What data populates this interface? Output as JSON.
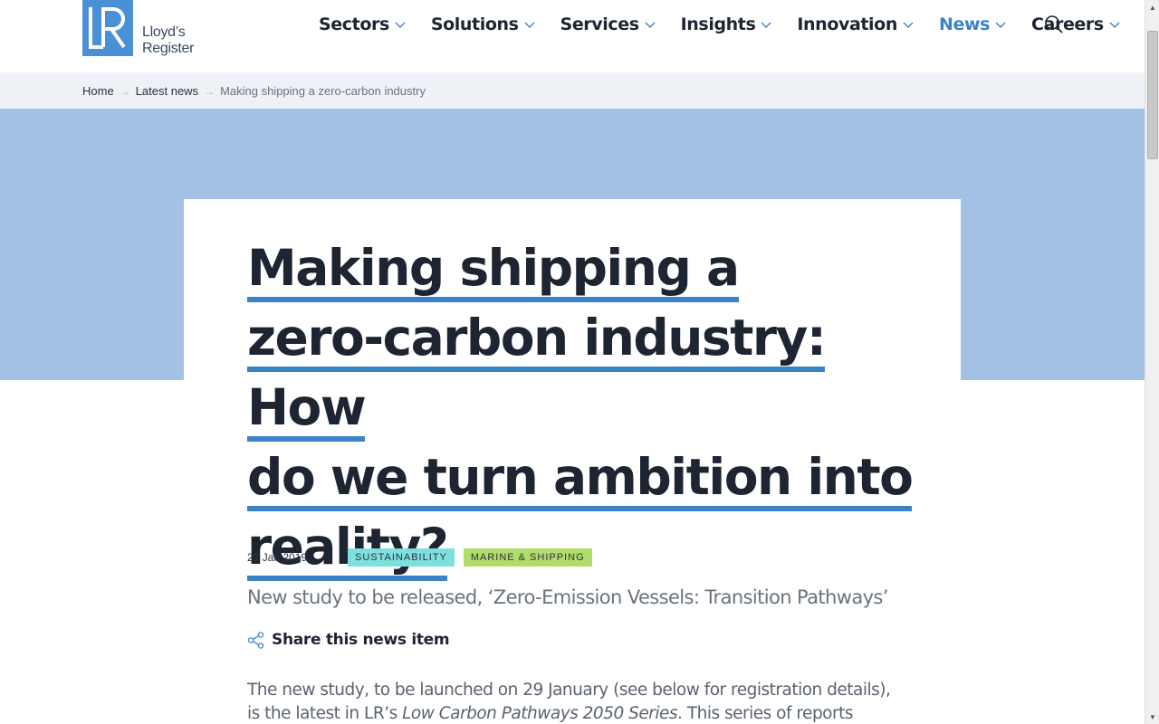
{
  "logo": {
    "name_line1": "Lloyd’s",
    "name_line2": "Register"
  },
  "nav": {
    "items": [
      {
        "label": "Sectors"
      },
      {
        "label": "Solutions"
      },
      {
        "label": "Services"
      },
      {
        "label": "Insights"
      },
      {
        "label": "Innovation"
      },
      {
        "label": "News",
        "active": true
      },
      {
        "label": "Careers"
      }
    ]
  },
  "breadcrumb": {
    "home": "Home",
    "latest": "Latest news",
    "current": "Making shipping a zero-carbon industry"
  },
  "article": {
    "title_lines": [
      "Making shipping a",
      "zero-carbon industry: How",
      "do we turn ambition into",
      "reality?"
    ],
    "date": "21 Jan 2019",
    "tags": [
      "SUSTAINABILITY",
      "MARINE & SHIPPING"
    ],
    "subtitle": "New study to be released, ‘Zero-Emission Vessels: Transition Pathways’",
    "share_label": "Share this news item",
    "body_p1_a": "The new study, to be launched on 29 January (see below for registration details), is the latest in LR’s ",
    "body_p1_em": "Low Carbon Pathways 2050 Series",
    "body_p1_b": ". This series of reports produced in"
  },
  "colors": {
    "accent": "#3b82c8",
    "hero": "#a2c1e4",
    "tag_sustainability": "#7ee0dc",
    "tag_marine": "#b2dc6a"
  }
}
